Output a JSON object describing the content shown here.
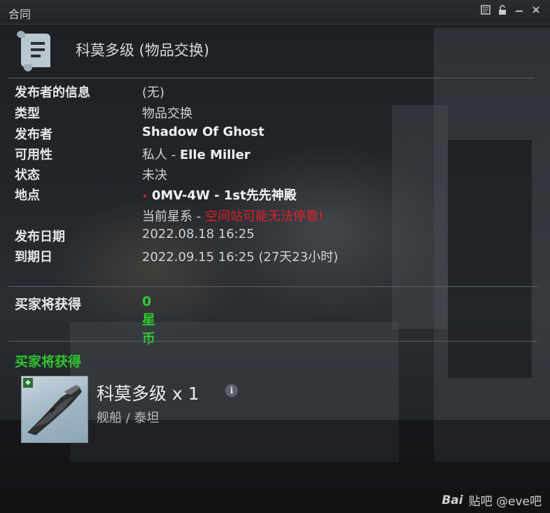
{
  "window": {
    "title": "合同",
    "icons": [
      "notes-icon",
      "lock-icon",
      "minimize-icon",
      "close-icon"
    ]
  },
  "header": {
    "title": "科莫多级 (物品交换)",
    "icon": "contract-document-icon"
  },
  "details": {
    "issuer_info": {
      "label": "发布者的信息",
      "value": "(无)"
    },
    "type": {
      "label": "类型",
      "value": "物品交换"
    },
    "issuer": {
      "label": "发布者",
      "value": "Shadow Of Ghost"
    },
    "availability": {
      "label": "可用性",
      "value_prefix": "私人 - ",
      "value_name": "Elle Miller"
    },
    "status": {
      "label": "状态",
      "value": "未决"
    },
    "location": {
      "label": "地点",
      "dot": "•",
      "value": "0MV-4W - 1st先先神殿",
      "sub_prefix": "当前星系 - ",
      "sub_warning": "空间站可能无法停靠!"
    },
    "issued": {
      "label": "发布日期",
      "value": "2022.08.18 16:25"
    },
    "expires": {
      "label": "到期日",
      "value": "2022.09.15 16:25 (27天23小时)"
    }
  },
  "buyer_gets_isk": {
    "label": "买家将获得",
    "value": "0 星币"
  },
  "buyer_gets_items": {
    "label": "买家将获得",
    "items": [
      {
        "name": "科莫多级 x 1",
        "type": "舰船 / 泰坦",
        "badge_icon": "diamond-badge-icon",
        "info_glyph": "i"
      }
    ]
  },
  "watermark": {
    "logo": "Bai",
    "text": "贴吧 @eve吧"
  },
  "colors": {
    "accent_green": "#32c832",
    "warning_red": "#e0202a",
    "panel_bg": "#1c1f23"
  }
}
